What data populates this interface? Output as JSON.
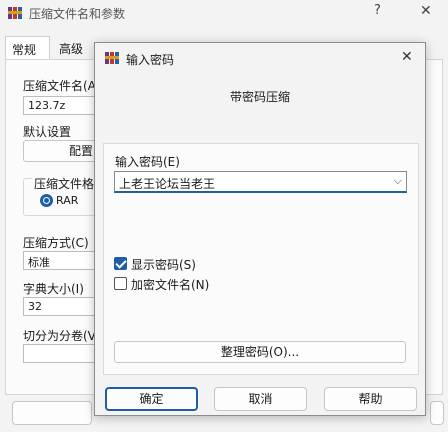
{
  "background_window": {
    "title": "压缩文件名和参数",
    "help_glyph": "?",
    "close_glyph": "✕",
    "tabs": [
      "常规",
      "高级"
    ],
    "archive_name_label": "压缩文件名(A)",
    "archive_name_value": "123.7z",
    "default_settings_label": "默认设置",
    "profiles_button": "配置",
    "format_group_label": "压缩文件格式",
    "format_rar_label": "RAR",
    "method_label": "压缩方式(C)",
    "method_value": "标准",
    "dict_label": "字典大小(I)",
    "dict_value": "32",
    "split_label": "切分为分卷(V)"
  },
  "dialog": {
    "title": "输入密码",
    "close_glyph": "✕",
    "heading": "带密码压缩",
    "password_label": "输入密码(E)",
    "password_value": "上老王论坛当老王",
    "dropdown_glyph": "⌵",
    "show_password_label": "显示密码(S)",
    "show_password_checked": true,
    "encrypt_names_label": "加密文件名(N)",
    "encrypt_names_checked": false,
    "organize_button": "整理密码(O)...",
    "ok_button": "确定",
    "cancel_button": "取消",
    "help_button": "帮助"
  },
  "colors": {
    "accent": "#1f5ea6",
    "icon_red": "#c0392b",
    "icon_purple": "#6c3483"
  }
}
